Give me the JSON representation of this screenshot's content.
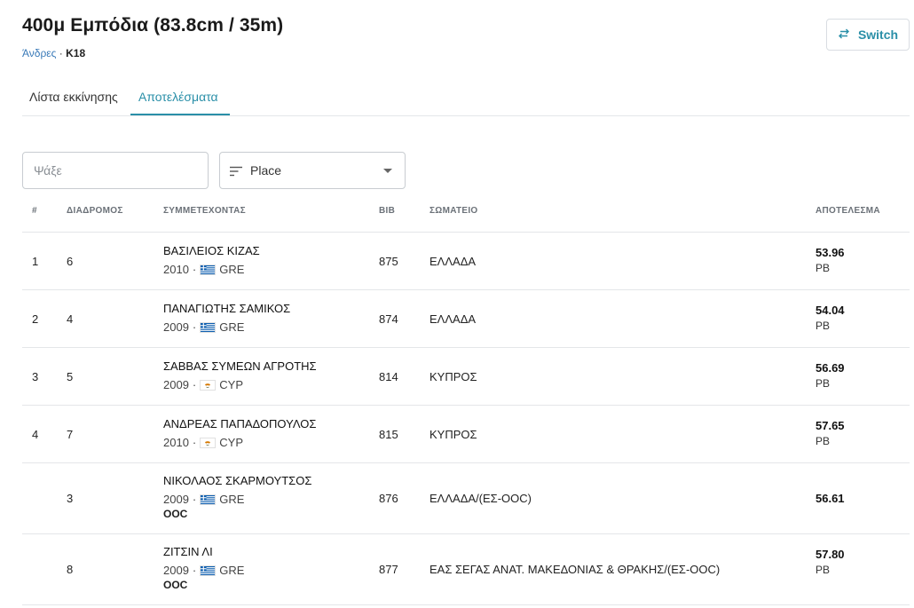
{
  "header": {
    "title": "400μ Εμπόδια (83.8cm / 35m)",
    "category": "Άνδρες",
    "separator": " · ",
    "age": "K18",
    "switch_label": "Switch"
  },
  "tabs": [
    {
      "label": "Λίστα εκκίνησης",
      "active": false
    },
    {
      "label": "Αποτελέσματα",
      "active": true
    }
  ],
  "search": {
    "placeholder": "Ψάξε",
    "value": ""
  },
  "sort": {
    "selected": "Place"
  },
  "columns": {
    "place": "#",
    "lane": "ΔΙΑΔΡΟΜΟΣ",
    "athlete": "ΣΥΜΜΕΤΕΧΟΝΤΑΣ",
    "bib": "BIB",
    "club": "ΣΩΜΑΤΕΙΟ",
    "result": "ΑΠΟΤΕΛΕΣΜΑ"
  },
  "rows": [
    {
      "place": "1",
      "lane": "6",
      "name": "ΒΑΣΙΛΕΙΟΣ ΚΙΖΑΣ",
      "year": "2010",
      "country": "GRE",
      "flag": "greece-flag-icon",
      "ooc": "",
      "bib": "875",
      "club": "ΕΛΛΑΔΑ",
      "result": "53.96",
      "note": "PB"
    },
    {
      "place": "2",
      "lane": "4",
      "name": "ΠΑΝΑΓΙΩΤΗΣ ΣΑΜΙΚΟΣ",
      "year": "2009",
      "country": "GRE",
      "flag": "greece-flag-icon",
      "ooc": "",
      "bib": "874",
      "club": "ΕΛΛΑΔΑ",
      "result": "54.04",
      "note": "PB"
    },
    {
      "place": "3",
      "lane": "5",
      "name": "ΣΑΒΒΑΣ ΣΥΜΕΩΝ ΑΓΡΟΤΗΣ",
      "year": "2009",
      "country": "CYP",
      "flag": "cyprus-flag-icon",
      "ooc": "",
      "bib": "814",
      "club": "ΚΥΠΡΟΣ",
      "result": "56.69",
      "note": "PB"
    },
    {
      "place": "4",
      "lane": "7",
      "name": "ΑΝΔΡΕΑΣ ΠΑΠΑΔΟΠΟΥΛΟΣ",
      "year": "2010",
      "country": "CYP",
      "flag": "cyprus-flag-icon",
      "ooc": "",
      "bib": "815",
      "club": "ΚΥΠΡΟΣ",
      "result": "57.65",
      "note": "PB"
    },
    {
      "place": "",
      "lane": "3",
      "name": "ΝΙΚΟΛΑΟΣ ΣΚΑΡΜΟΥΤΣΟΣ",
      "year": "2009",
      "country": "GRE",
      "flag": "greece-flag-icon",
      "ooc": "OOC",
      "bib": "876",
      "club": "ΕΛΛΑΔΑ/(ΕΣ-ΟΟC)",
      "result": "56.61",
      "note": ""
    },
    {
      "place": "",
      "lane": "8",
      "name": "ΖΙΤΣΙΝ ΛΙ",
      "year": "2009",
      "country": "GRE",
      "flag": "greece-flag-icon",
      "ooc": "OOC",
      "bib": "877",
      "club": "ΕΑΣ ΣΕΓΑΣ ΑΝΑΤ. ΜΑΚΕΔΟΝΙΑΣ & ΘΡΑΚΗΣ/(ΕΣ-ΟΟC)",
      "result": "57.80",
      "note": "PB"
    }
  ],
  "colors": {
    "accent": "#2a8fa8",
    "link": "#3a7ab8",
    "greece_blue": "#0d5eaf",
    "cyprus_copper": "#d57800"
  }
}
